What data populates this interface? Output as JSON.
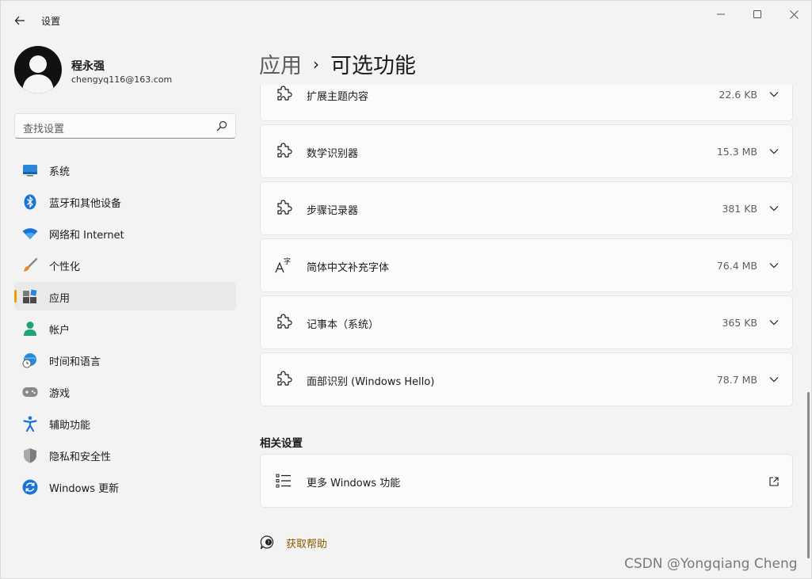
{
  "window": {
    "title": "设置"
  },
  "profile": {
    "name": "程永强",
    "email": "chengyq116@163.com"
  },
  "search": {
    "placeholder": "查找设置"
  },
  "sidebar": {
    "items": [
      {
        "label": "系统",
        "icon": "monitor-icon"
      },
      {
        "label": "蓝牙和其他设备",
        "icon": "bluetooth-icon"
      },
      {
        "label": "网络和 Internet",
        "icon": "wifi-icon"
      },
      {
        "label": "个性化",
        "icon": "brush-icon"
      },
      {
        "label": "应用",
        "icon": "apps-icon",
        "active": true
      },
      {
        "label": "帐户",
        "icon": "account-icon"
      },
      {
        "label": "时间和语言",
        "icon": "globe-clock-icon"
      },
      {
        "label": "游戏",
        "icon": "gamepad-icon"
      },
      {
        "label": "辅助功能",
        "icon": "accessibility-icon"
      },
      {
        "label": "隐私和安全性",
        "icon": "shield-icon"
      },
      {
        "label": "Windows 更新",
        "icon": "update-icon"
      }
    ]
  },
  "breadcrumb": {
    "parent": "应用",
    "separator": "›",
    "current": "可选功能"
  },
  "features": [
    {
      "label": "扩展主题内容",
      "size": "22.6 KB",
      "icon": "puzzle-icon"
    },
    {
      "label": "数学识别器",
      "size": "15.3 MB",
      "icon": "puzzle-icon"
    },
    {
      "label": "步骤记录器",
      "size": "381 KB",
      "icon": "puzzle-icon"
    },
    {
      "label": "简体中文补充字体",
      "size": "76.4 MB",
      "icon": "font-icon"
    },
    {
      "label": "记事本（系统）",
      "size": "365 KB",
      "icon": "puzzle-icon"
    },
    {
      "label": "面部识别 (Windows Hello)",
      "size": "78.7 MB",
      "icon": "puzzle-icon"
    }
  ],
  "related": {
    "title": "相关设置",
    "item": {
      "label": "更多 Windows 功能",
      "icon": "list-icon"
    }
  },
  "help": {
    "label": "获取帮助"
  },
  "watermark": "CSDN @Yongqiang Cheng",
  "colors": {
    "accent": "#e8a200",
    "link": "#8a5a00"
  }
}
